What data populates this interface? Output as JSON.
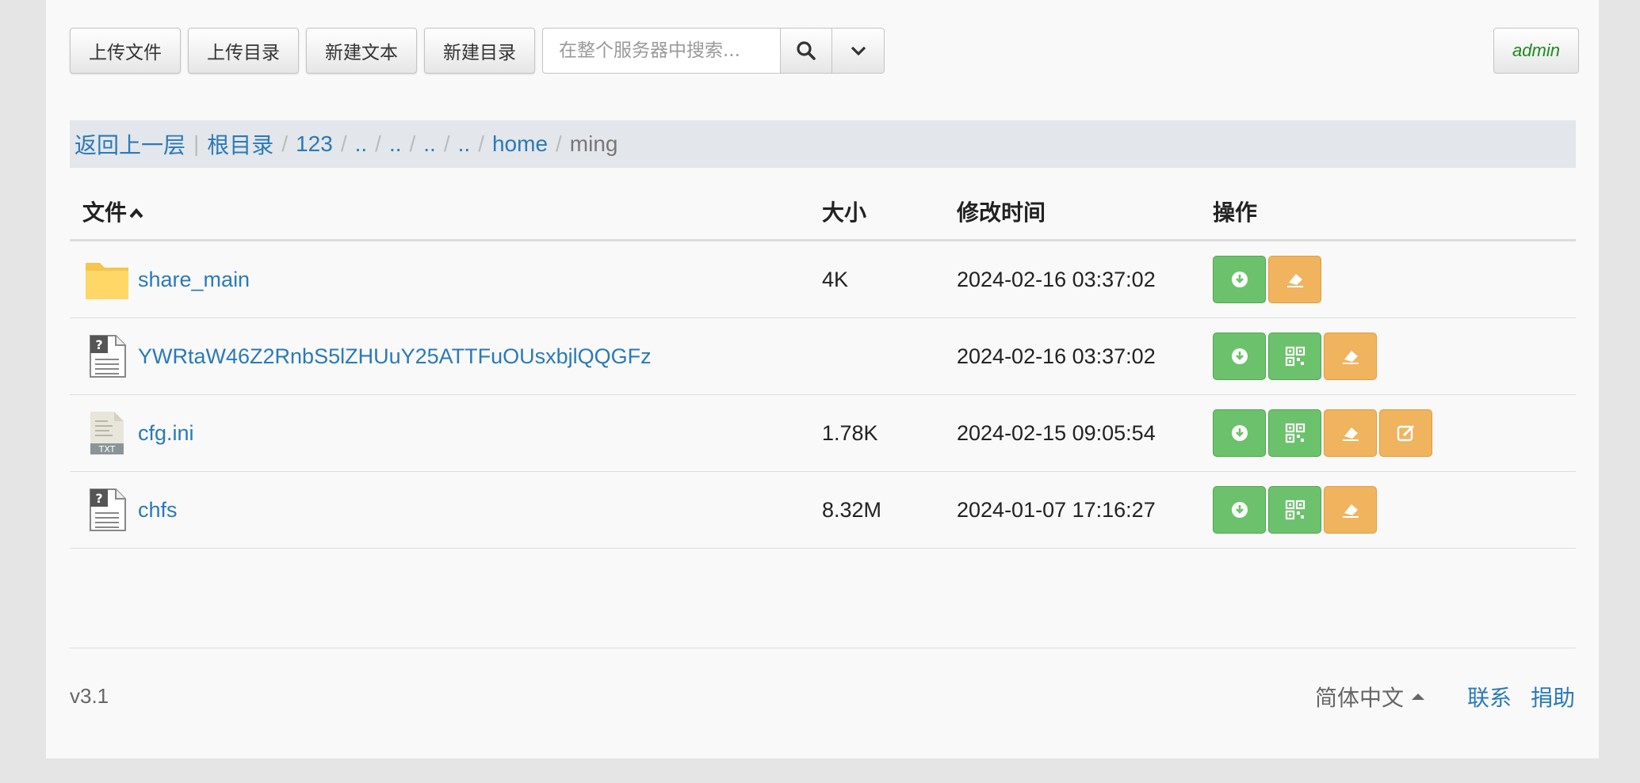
{
  "toolbar": {
    "upload_file": "上传文件",
    "upload_dir": "上传目录",
    "new_text": "新建文本",
    "new_dir": "新建目录",
    "search_placeholder": "在整个服务器中搜索...",
    "user": "admin"
  },
  "breadcrumb": {
    "back": "返回上一层",
    "pipe": "|",
    "root": "根目录",
    "items": [
      "123",
      "..",
      "..",
      "..",
      "..",
      "home"
    ],
    "current": "ming",
    "sep": "/"
  },
  "table": {
    "headers": {
      "name": "文件",
      "size": "大小",
      "mtime": "修改时间",
      "ops": "操作"
    },
    "rows": [
      {
        "name": "share_main",
        "size": "4K",
        "mtime": "2024-02-16 03:37:02",
        "icon": "folder-icon"
      },
      {
        "name": "YWRtaW46Z2RnbS5lZHUuY25ATTFuOUsxbjlQQGFz",
        "size": "",
        "mtime": "2024-02-16 03:37:02",
        "icon": "unknown-file-icon"
      },
      {
        "name": "cfg.ini",
        "size": "1.78K",
        "mtime": "2024-02-15 09:05:54",
        "icon": "txt-file-icon"
      },
      {
        "name": "chfs",
        "size": "8.32M",
        "mtime": "2024-01-07 17:16:27",
        "icon": "unknown-file-icon"
      }
    ]
  },
  "footer": {
    "version": "v3.1",
    "language": "简体中文",
    "contact": "联系",
    "donate": "捐助"
  },
  "colors": {
    "link": "#2a7ab8",
    "green_button": "#6cc26c",
    "orange_button": "#f0b35e",
    "admin_text": "#1c8a1c"
  }
}
